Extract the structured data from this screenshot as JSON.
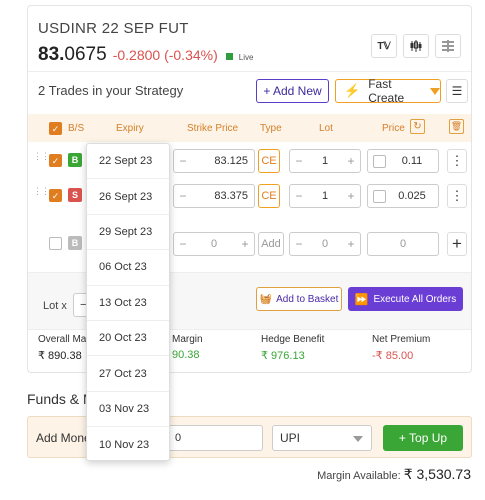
{
  "instrument": {
    "title": "USDINR 22 SEP FUT",
    "price_main": "83.",
    "price_dec": "0675",
    "change": "-0.2800 (-0.34%)",
    "live_label": "Live"
  },
  "strategy": {
    "title": "2 Trades in your Strategy",
    "add_new": "+ Add New",
    "fast_create": "Fast Create"
  },
  "table": {
    "headers": {
      "bs": "B/S",
      "expiry": "Expiry",
      "strike": "Strike Price",
      "type": "Type",
      "lot": "Lot",
      "price": "Price"
    },
    "rows": [
      {
        "bs": "B",
        "bs_color": "#3aa635",
        "strike": "83.125",
        "type": "CE",
        "lot": "1",
        "price": "0.11"
      },
      {
        "bs": "S",
        "bs_color": "#d9534f",
        "strike": "83.375",
        "type": "CE",
        "lot": "1",
        "price": "0.025"
      }
    ],
    "new_row": {
      "bs": "B",
      "strike": "0",
      "type": "Add",
      "lot": "0",
      "price": "0"
    }
  },
  "actions": {
    "lot_label": "Lot x",
    "add_basket": "Add to Basket",
    "execute": "Execute All Orders"
  },
  "stats": [
    {
      "label": "Overall Ma",
      "value": "₹ 890.38",
      "color": "#222"
    },
    {
      "label": "Margin",
      "value": "90.38",
      "color": "#3aa635"
    },
    {
      "label": "Hedge Benefit",
      "value": "₹ 976.13",
      "color": "#3aa635"
    },
    {
      "label": "Net Premium",
      "value": "-₹ 85.00",
      "color": "#d9534f"
    }
  ],
  "funds": {
    "title": "Funds & M",
    "add_money": "Add Mone",
    "amount": "0",
    "method": "UPI",
    "top_up": "+ Top Up",
    "margin_label": "Margin Available:",
    "margin_value": "₹ 3,530.73"
  },
  "expiry_options": [
    "22 Sept 23",
    "26 Sept 23",
    "29 Sept 23",
    "06 Oct 23",
    "13 Oct 23",
    "20 Oct 23",
    "27 Oct 23",
    "03 Nov 23",
    "10 Nov 23"
  ]
}
